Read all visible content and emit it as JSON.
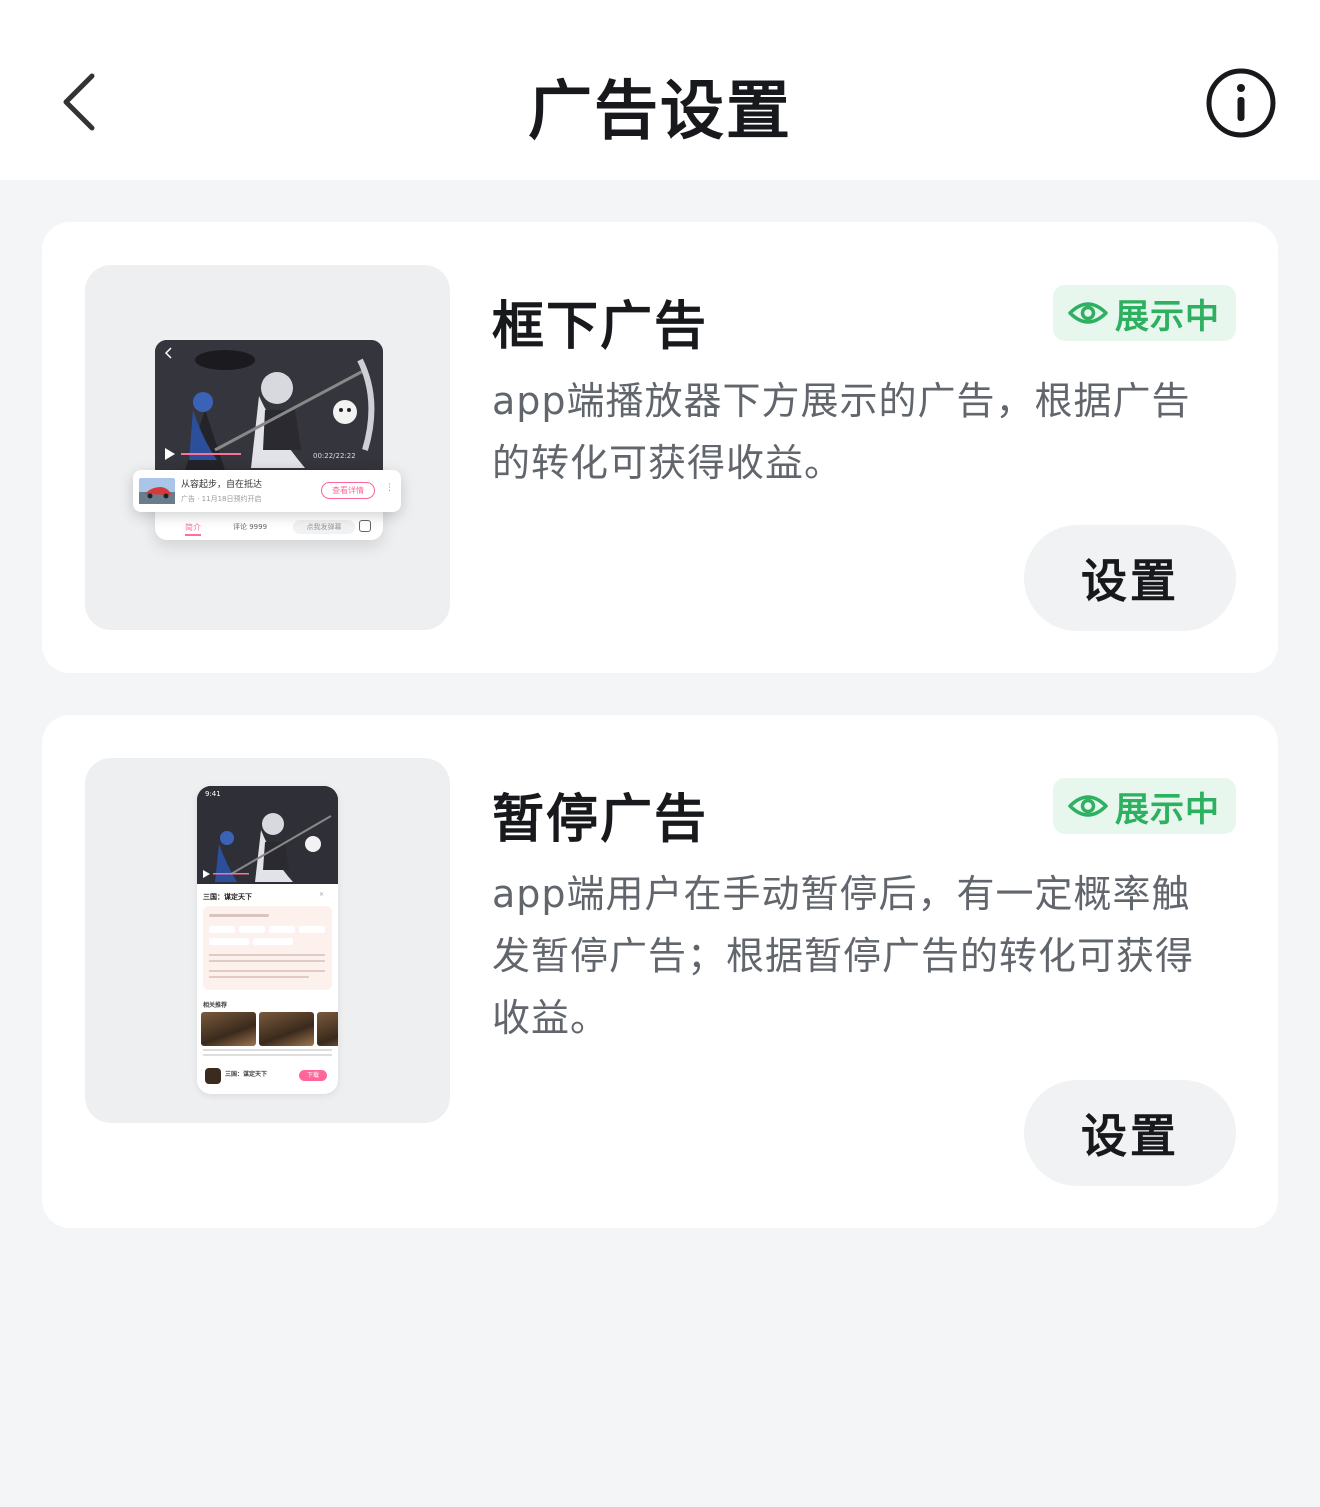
{
  "header": {
    "title": "广告设置",
    "back_icon": "chevron-left-icon",
    "info_icon": "info-circle-icon"
  },
  "cards": [
    {
      "title": "框下广告",
      "status": "展示中",
      "status_icon": "eye-icon",
      "description": "app端播放器下方展示的广告，根据广告的转化可获得收益。",
      "button": "设置",
      "preview": {
        "ad_title": "从容起步，自在抵达",
        "ad_meta": "广告 · 11月18日预约开启",
        "ad_button": "查看详情",
        "time": "00:22/22:22",
        "tab_intro": "简介",
        "tab_comments": "评论 9999",
        "danmaku_placeholder": "点我发弹幕"
      }
    },
    {
      "title": "暂停广告",
      "status": "展示中",
      "status_icon": "eye-icon",
      "description": "app端用户在手动暂停后，有一定概率触发暂停广告；根据暂停广告的转化可获得收益。",
      "button": "设置",
      "preview": {
        "clock": "9:41",
        "game_title": "三国：谋定天下",
        "related": "相关推荐",
        "bottom_title": "三国：谋定天下",
        "download": "下载"
      }
    }
  ],
  "colors": {
    "background": "#f4f5f7",
    "card": "#ffffff",
    "status_green": "#2eb061",
    "status_bg": "#e8f7ee",
    "button_bg": "#f1f2f3",
    "accent_pink": "#ff6699"
  }
}
